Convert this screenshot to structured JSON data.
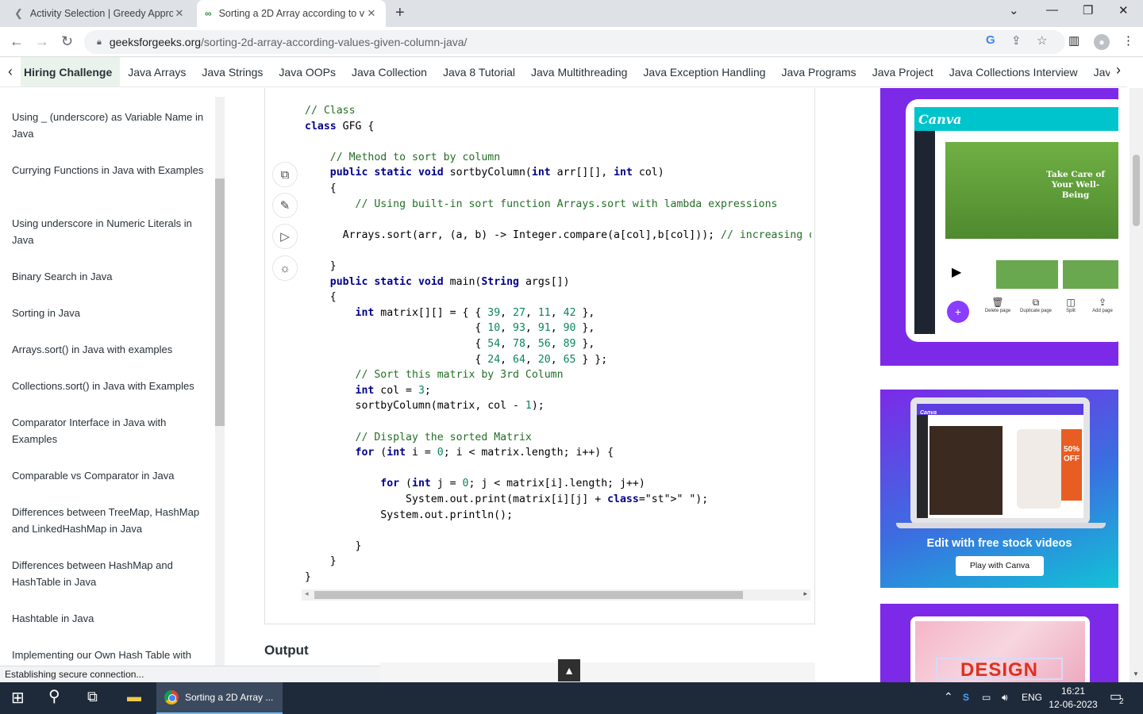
{
  "browser": {
    "tabs": [
      {
        "title": "Activity Selection | Greedy Appro",
        "close": "✕"
      },
      {
        "title": "Sorting a 2D Array according to v",
        "close": "✕"
      }
    ],
    "new_tab": "+",
    "url_host": "geeksforgeeks.org",
    "url_path": "/sorting-2d-array-according-values-given-column-java/"
  },
  "nav": {
    "items": [
      "Hiring Challenge",
      "Java Arrays",
      "Java Strings",
      "Java OOPs",
      "Java Collection",
      "Java 8 Tutorial",
      "Java Multithreading",
      "Java Exception Handling",
      "Java Programs",
      "Java Project",
      "Java Collections Interview",
      "Java Inter"
    ]
  },
  "sidebar": {
    "items": [
      "Using _ (underscore) as Variable Name in Java",
      "Currying Functions in Java with Examples",
      "Using underscore in Numeric Literals in Java",
      "Binary Search in Java",
      "Sorting in Java",
      "Arrays.sort() in Java with examples",
      "Collections.sort() in Java with Examples",
      "Comparator Interface in Java with Examples",
      "Comparable vs Comparator in Java",
      "Differences between TreeMap, HashMap and LinkedHashMap in Java",
      "Differences between HashMap and HashTable in Java",
      "Hashtable in Java",
      "Implementing our Own Hash Table with"
    ]
  },
  "code_lines": [
    "// Class",
    "class GFG {",
    "",
    "    // Method to sort by column",
    "    public static void sortbyColumn(int arr[][], int col)",
    "    {",
    "        // Using built-in sort function Arrays.sort with lambda expressions",
    "",
    "      Arrays.sort(arr, (a, b) -> Integer.compare(a[col],b[col])); // increasing order",
    "",
    "    }",
    "    public static void main(String args[])",
    "    {",
    "        int matrix[][] = { { 39, 27, 11, 42 },",
    "                           { 10, 93, 91, 90 },",
    "                           { 54, 78, 56, 89 },",
    "                           { 24, 64, 20, 65 } };",
    "        // Sort this matrix by 3rd Column",
    "        int col = 3;",
    "        sortbyColumn(matrix, col - 1);",
    "",
    "        // Display the sorted Matrix",
    "        for (int i = 0; i < matrix.length; i++) {",
    "",
    "            for (int j = 0; j < matrix[i].length; j++)",
    "                System.out.print(matrix[i][j] + \" \");",
    "            System.out.println();",
    "",
    "        }",
    "    }",
    "}"
  ],
  "code_icons": [
    "copy-icon",
    "edit-icon",
    "run-icon",
    "theme-icon"
  ],
  "output_heading": "Output",
  "status_text": "Establishing secure connection...",
  "ads": {
    "ad1": {
      "brand": "Canva",
      "photo_text": "Take Care of Your Well-Being",
      "tools": [
        "Delete page",
        "Duplicate page",
        "Split",
        "Add page"
      ]
    },
    "ad2": {
      "brand": "Canva",
      "promo": "50% OFF",
      "headline": "Edit with free stock videos",
      "cta": "Play with Canva"
    },
    "ad3": {
      "word": "DESIGN"
    }
  },
  "taskbar": {
    "app_label": "Sorting a 2D Array ...",
    "lang": "ENG",
    "time": "16:21",
    "date": "12-06-2023",
    "notifications": "2"
  }
}
